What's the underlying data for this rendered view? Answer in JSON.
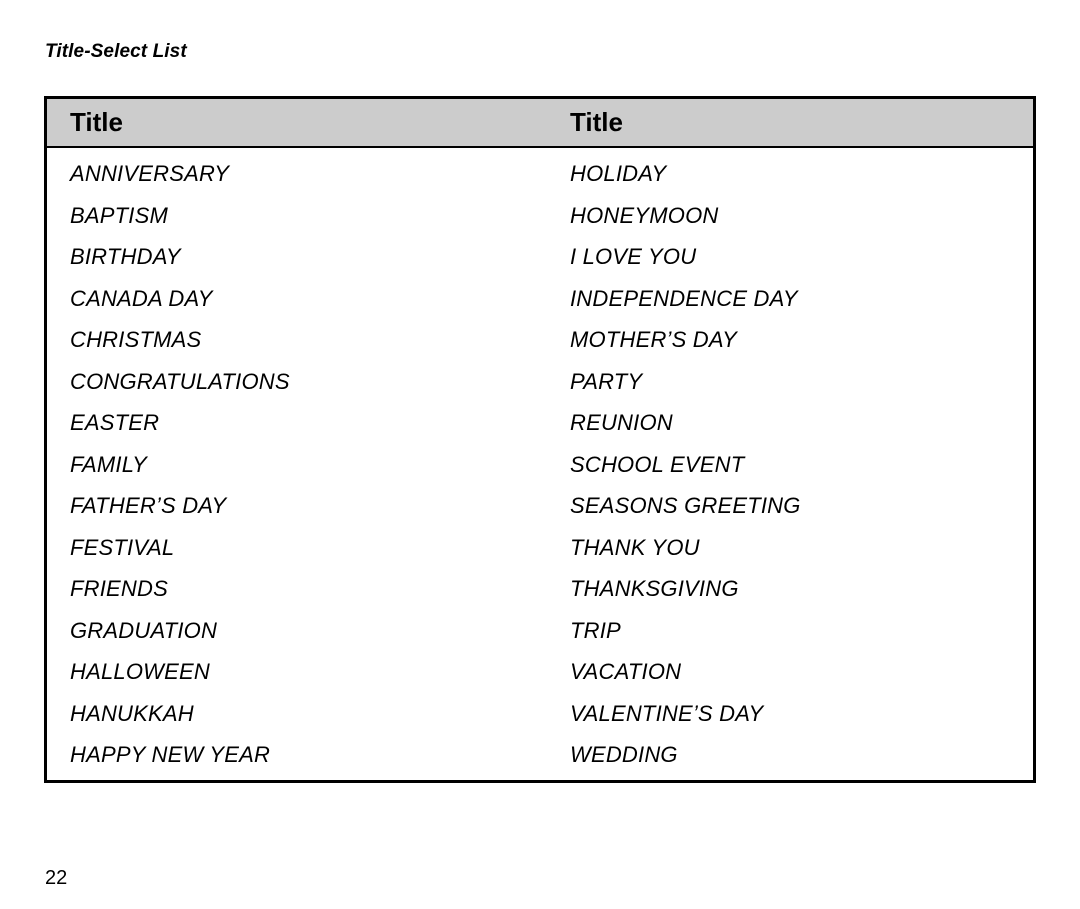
{
  "page": {
    "section_title": "Title-Select List",
    "page_number": "22",
    "header_background": "#cccccc",
    "border_color": "#000000",
    "text_color": "#000000"
  },
  "table": {
    "columns": [
      {
        "header": "Title"
      },
      {
        "header": "Title"
      }
    ],
    "rows": [
      {
        "col1": "ANNIVERSARY",
        "col2": "HOLIDAY"
      },
      {
        "col1": "BAPTISM",
        "col2": "HONEYMOON"
      },
      {
        "col1": "BIRTHDAY",
        "col2": "I LOVE YOU"
      },
      {
        "col1": "CANADA DAY",
        "col2": "INDEPENDENCE DAY"
      },
      {
        "col1": "CHRISTMAS",
        "col2": "MOTHER’S DAY"
      },
      {
        "col1": "CONGRATULATIONS",
        "col2": "PARTY"
      },
      {
        "col1": "EASTER",
        "col2": "REUNION"
      },
      {
        "col1": "FAMILY",
        "col2": "SCHOOL EVENT"
      },
      {
        "col1": "FATHER’S DAY",
        "col2": "SEASONS GREETING"
      },
      {
        "col1": "FESTIVAL",
        "col2": "THANK YOU"
      },
      {
        "col1": "FRIENDS",
        "col2": "THANKSGIVING"
      },
      {
        "col1": "GRADUATION",
        "col2": "TRIP"
      },
      {
        "col1": "HALLOWEEN",
        "col2": "VACATION"
      },
      {
        "col1": "HANUKKAH",
        "col2": "VALENTINE’S DAY"
      },
      {
        "col1": "HAPPY NEW YEAR",
        "col2": "WEDDING"
      }
    ]
  }
}
